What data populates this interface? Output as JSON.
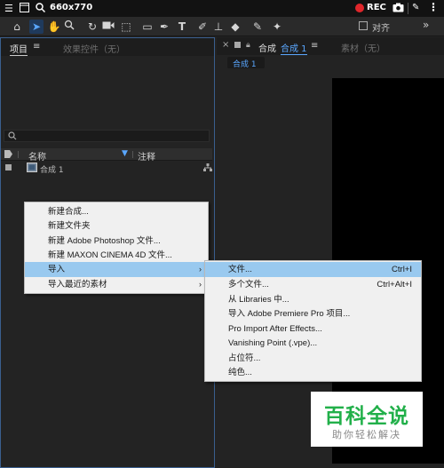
{
  "recorder": {
    "dimensions": "660x770",
    "rec_label": "REC"
  },
  "toolbar": {
    "align_label": "对齐"
  },
  "left_panel": {
    "tab_project": "项目",
    "tab_effects": "效果控件（无）",
    "columns": {
      "name": "名称",
      "comment": "注释"
    },
    "item_name": "合成 1"
  },
  "right_panel": {
    "tab_composition_prefix": "合成",
    "tab_composition_name": "合成 1",
    "tab_footage": "素材（无）",
    "breadcrumb": "合成 1"
  },
  "context_menu": {
    "items": [
      {
        "label": "新建合成..."
      },
      {
        "label": "新建文件夹"
      },
      {
        "label": "新建 Adobe Photoshop 文件..."
      },
      {
        "label": "新建 MAXON CINEMA 4D 文件..."
      },
      {
        "label": "导入",
        "has_submenu": true,
        "highlighted": true
      },
      {
        "label": "导入最近的素材",
        "has_submenu": true
      }
    ]
  },
  "import_submenu": {
    "items": [
      {
        "label": "文件...",
        "shortcut": "Ctrl+I",
        "highlighted": true
      },
      {
        "label": "多个文件...",
        "shortcut": "Ctrl+Alt+I"
      },
      {
        "label": "从 Libraries 中..."
      },
      {
        "label": "导入 Adobe Premiere Pro 项目..."
      },
      {
        "label": "Pro Import After Effects..."
      },
      {
        "label": "Vanishing Point (.vpe)..."
      },
      {
        "label": "占位符..."
      },
      {
        "label": "纯色..."
      }
    ]
  },
  "watermark": {
    "title": "百科全说",
    "subtitle": "助你轻松解决"
  },
  "colors": {
    "highlight": "#99c9ef",
    "rec": "#e0262b",
    "accent_blue": "#5aa7ff",
    "watermark_green": "#22b04a"
  }
}
